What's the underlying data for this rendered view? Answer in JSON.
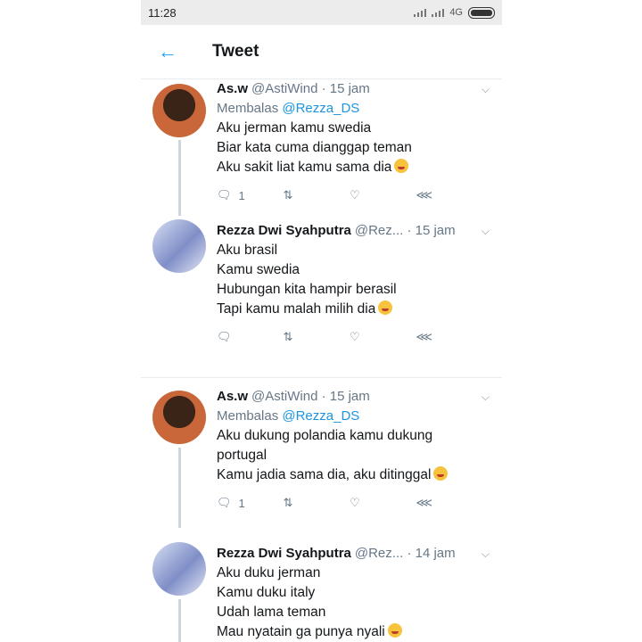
{
  "status": {
    "time": "11:28",
    "network": "4G"
  },
  "header": {
    "title": "Tweet"
  },
  "colors": {
    "accent": "#1da1f2",
    "mention": "#1b95e0",
    "meta": "#657786"
  },
  "tweets": [
    {
      "name": "As.w",
      "handle": "@AstiWind · 15 jam",
      "reply_prefix": "Membalas ",
      "reply_to": "@Rezza_DS",
      "lines": [
        "Aku jerman kamu swedia",
        "Biar kata cuma dianggap teman",
        "Aku sakit liat kamu sama dia"
      ],
      "reply_count": "1"
    },
    {
      "name": "Rezza Dwi Syahputra",
      "handle": "@Rez... · 15 jam",
      "lines": [
        "Aku brasil",
        "Kamu swedia",
        "Hubungan kita hampir berasil",
        "Tapi kamu malah milih dia"
      ],
      "reply_count": ""
    },
    {
      "name": "As.w",
      "handle": "@AstiWind · 15 jam",
      "reply_prefix": "Membalas ",
      "reply_to": "@Rezza_DS",
      "lines": [
        "Aku dukung polandia kamu dukung",
        "portugal",
        "Kamu jadia sama dia, aku ditinggal"
      ],
      "reply_count": "1"
    },
    {
      "name": "Rezza Dwi Syahputra",
      "handle": "@Rez... · 14 jam",
      "lines": [
        "Aku duku jerman",
        "Kamu duku italy",
        "Udah lama teman",
        "Mau nyatain ga punya nyali"
      ],
      "reply_count": ""
    }
  ]
}
